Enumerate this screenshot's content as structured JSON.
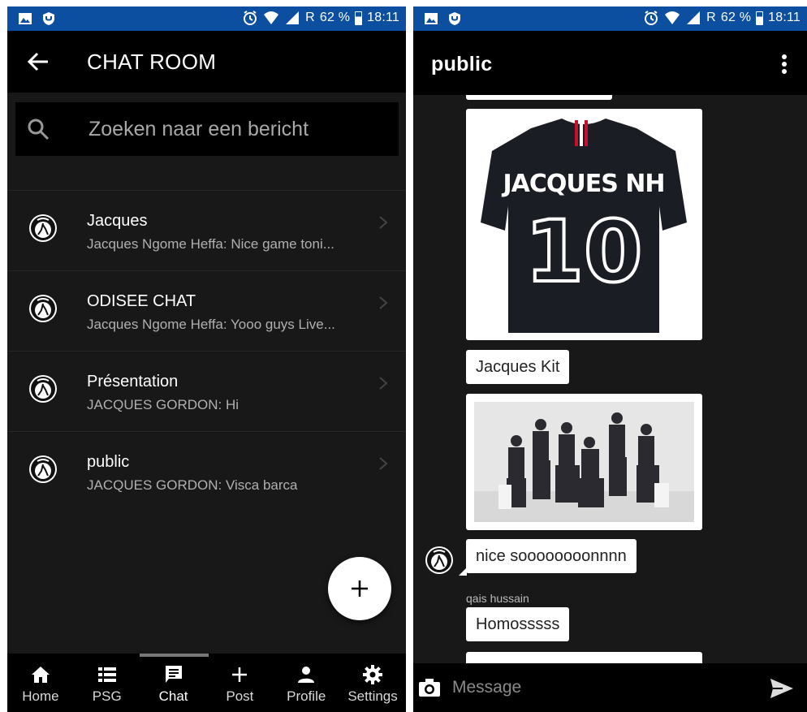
{
  "left_screen": {
    "status": {
      "battery": "62 %",
      "time": "18:11",
      "roaming": "R"
    },
    "toolbar": {
      "title": "CHAT ROOM"
    },
    "search": {
      "placeholder": "Zoeken naar een bericht"
    },
    "chats": [
      {
        "name": "Jacques",
        "last_message": "Jacques Ngome Heffa: Nice game toni..."
      },
      {
        "name": "ODISEE CHAT",
        "last_message": "Jacques Ngome Heffa: Yooo guys Live..."
      },
      {
        "name": "Présentation",
        "last_message": "JACQUES GORDON: Hi"
      },
      {
        "name": "public",
        "last_message": "JACQUES GORDON: Visca barca"
      }
    ],
    "nav": [
      {
        "label": "Home",
        "icon": "home-icon"
      },
      {
        "label": "PSG",
        "icon": "list-icon"
      },
      {
        "label": "Chat",
        "icon": "chat-icon",
        "active": true
      },
      {
        "label": "Post",
        "icon": "plus-icon"
      },
      {
        "label": "Profile",
        "icon": "person-icon"
      },
      {
        "label": "Settings",
        "icon": "gear-icon"
      }
    ]
  },
  "right_screen": {
    "status": {
      "battery": "62 %",
      "time": "18:11",
      "roaming": "R"
    },
    "toolbar": {
      "title": "public"
    },
    "messages": {
      "jersey_text": "JACQUES NH",
      "jersey_number": "10",
      "caption": "Jacques Kit",
      "reply": "nice soooooooonnnn",
      "sender": "qais hussain",
      "sender_message": "Homosssss"
    },
    "composer": {
      "placeholder": "Message"
    }
  },
  "colors": {
    "statusbar": "#0c4fa0",
    "background": "#181818",
    "toolbar": "#000000",
    "bubble": "#ffffff"
  }
}
